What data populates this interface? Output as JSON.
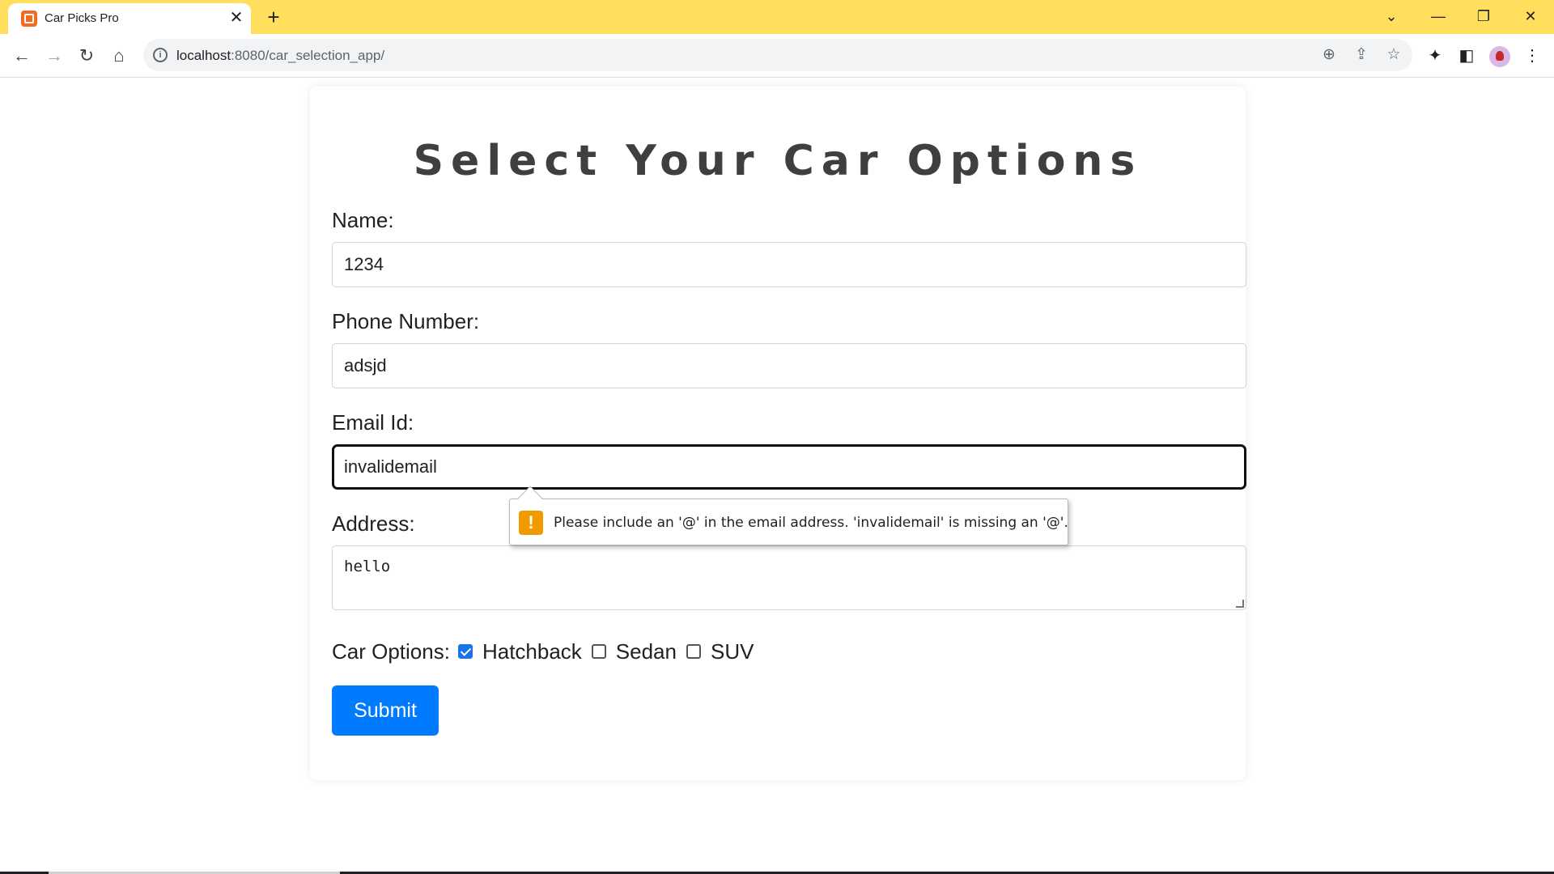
{
  "browser": {
    "tab_title": "Car Picks Pro",
    "tab_close": "✕",
    "new_tab": "+",
    "url_host": "localhost",
    "url_path": ":8080/car_selection_app/",
    "icons": [
      "back-icon",
      "forward-icon",
      "reload-icon",
      "home-icon",
      "info-icon",
      "zoom-icon",
      "share-icon",
      "bookmark-star-icon",
      "extensions-icon",
      "side-panel-icon",
      "profile-avatar",
      "menu-icon"
    ]
  },
  "page": {
    "title": "Select Your Car Options",
    "fields": {
      "name": {
        "label": "Name:",
        "value": "1234"
      },
      "phone": {
        "label": "Phone Number:",
        "value": "adsjd"
      },
      "email": {
        "label": "Email Id:",
        "value": "invalidemail"
      },
      "address": {
        "label": "Address:",
        "value": "hello"
      }
    },
    "car_options": {
      "label": "Car Options:",
      "options": [
        {
          "label": "Hatchback",
          "checked": true
        },
        {
          "label": "Sedan",
          "checked": false
        },
        {
          "label": "SUV",
          "checked": false
        }
      ]
    },
    "submit_label": "Submit"
  },
  "validation": {
    "icon": "!",
    "message": "Please include an '@' in the email address. 'invalidemail' is missing an '@'."
  },
  "colors": {
    "tabstrip": "#ffdf5d",
    "submit": "#007bff",
    "warning": "#f29900"
  }
}
